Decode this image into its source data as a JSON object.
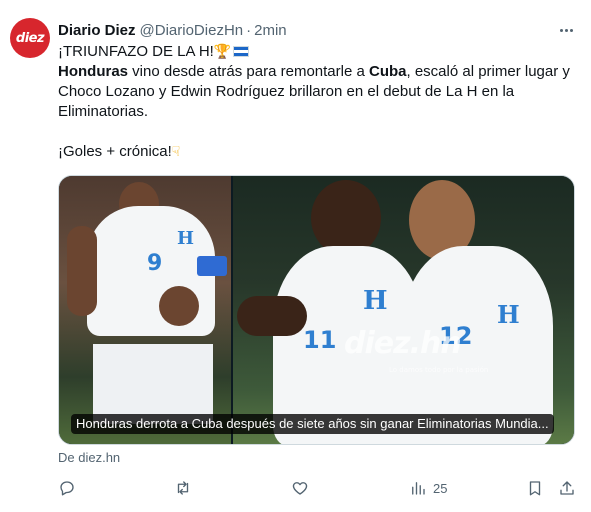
{
  "author": {
    "name": "Diario Diez",
    "handle": "@DiarioDiezHn",
    "separator": "·",
    "time": "2min",
    "avatar_text": "diez"
  },
  "tweet": {
    "line1": "¡TRIUNFAZO DE LA H!",
    "p1_bold1": "Honduras",
    "p1_text1": " vino desde atrás para remontarle a ",
    "p1_bold2": "Cuba",
    "p1_text2": ", escaló al primer lugar y Choco Lozano y Edwin Rodríguez brillaron en el debut de La H en la Eliminatorias.",
    "line3": "¡Goles + crónica!"
  },
  "card": {
    "caption": "Honduras derrota a Cuba después de siete años sin ganar Eliminatorias Mundia...",
    "watermark": "diez.hn",
    "watermark_sub": "Lo damos todo por la pasión",
    "jersey_left_number": "9",
    "jersey_right_number_1": "11",
    "jersey_right_number_2": "12",
    "crest_letter": "H"
  },
  "source": "De diez.hn",
  "actions": {
    "reply_count": "",
    "retweet_count": "",
    "like_count": "",
    "views_count": "25"
  },
  "colors": {
    "brand_red": "#d7262d",
    "secondary_text": "#536471",
    "primary_text": "#0f1419"
  },
  "icons": [
    "more-icon",
    "trophy-icon",
    "honduras-flag-icon",
    "pointing-down-icon",
    "reply-icon",
    "retweet-icon",
    "like-icon",
    "views-icon",
    "bookmark-icon",
    "share-icon"
  ]
}
